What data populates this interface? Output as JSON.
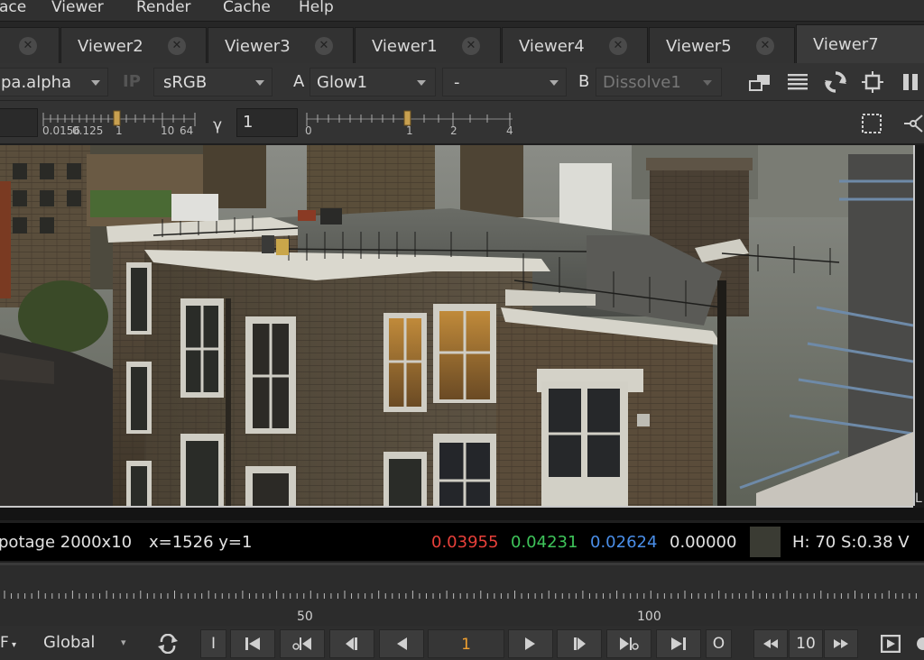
{
  "menu": {
    "items": [
      "ace",
      "Viewer",
      "Render",
      "Cache",
      "Help"
    ]
  },
  "tabs": [
    {
      "label": "Viewer2",
      "active": false
    },
    {
      "label": "Viewer3",
      "active": false
    },
    {
      "label": "Viewer1",
      "active": false
    },
    {
      "label": "Viewer4",
      "active": false
    },
    {
      "label": "Viewer5",
      "active": false
    },
    {
      "label": "Viewer7",
      "active": true
    }
  ],
  "toolbar": {
    "channel": "pa.alpha",
    "ip_label": "IP",
    "colorspace": "sRGB",
    "input_a_label": "A",
    "input_a": "Glow1",
    "wipe_mode": "-",
    "input_b_label": "B",
    "input_b": "Dissolve1",
    "gain_ticks": [
      "0.0156",
      "0.125",
      "1",
      "10",
      "64"
    ],
    "gamma_label": "γ",
    "gamma_value": "1",
    "gamma_ticks": [
      "0",
      "1",
      "2",
      "4"
    ]
  },
  "info": {
    "format": "potage 2000x10",
    "coords": "x=1526 y=1",
    "r": "0.03955",
    "g": "0.04231",
    "b": "0.02624",
    "a": "0.00000",
    "hsv": "H: 70 S:0.38 V",
    "swatch_color": "#3a3b33"
  },
  "timeline": {
    "labels": [
      "50",
      "100"
    ]
  },
  "controls": {
    "fps_label": "F",
    "scope": "Global",
    "in_point": "I",
    "out_point": "O",
    "current_frame": "1",
    "increment": "10"
  },
  "colors": {
    "red": "#e8403a",
    "green": "#3ec45a",
    "blue": "#4a8ee8",
    "frame_orange": "#f0a030"
  }
}
